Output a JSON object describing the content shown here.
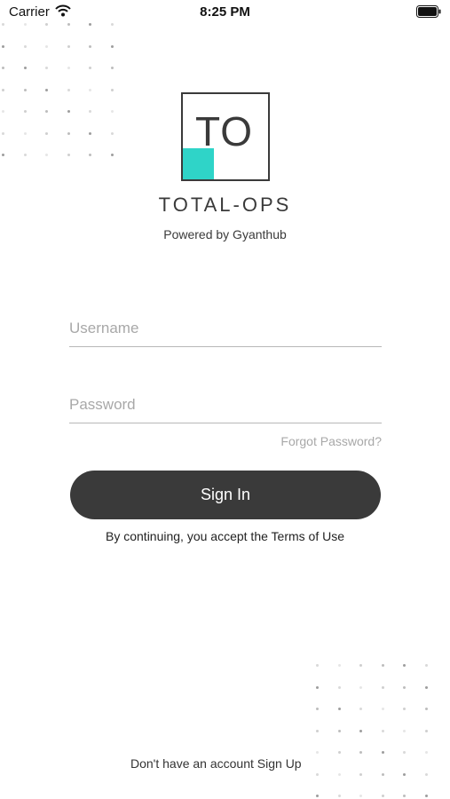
{
  "status_bar": {
    "carrier": "Carrier",
    "time": "8:25 PM"
  },
  "logo": {
    "letters": "TO",
    "accent_color": "#2fd4c8"
  },
  "brand": {
    "name": "TOTAL-OPS",
    "powered_by": "Powered by Gyanthub"
  },
  "form": {
    "username_placeholder": "Username",
    "password_placeholder": "Password",
    "forgot_label": "Forgot Password?",
    "signin_label": "Sign In",
    "terms_text": "By continuing, you accept the Terms of Use"
  },
  "footer": {
    "prompt": "Don't have an account",
    "signup_label": "Sign Up"
  },
  "colors": {
    "primary": "#3a3a3a",
    "accent": "#2fd4c8",
    "muted": "#a8a8a8"
  }
}
